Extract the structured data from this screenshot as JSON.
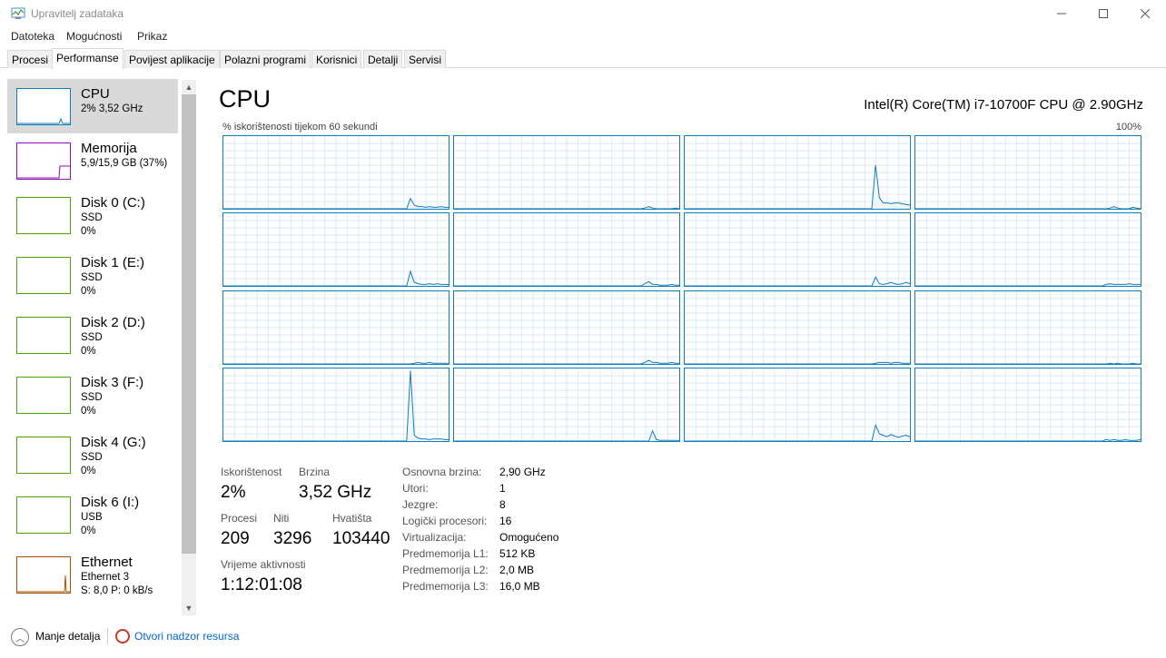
{
  "window": {
    "title": "Upravitelj zadataka",
    "icons": {
      "app": "task-manager-icon",
      "minimize": "minimize-icon",
      "maximize": "maximize-icon",
      "close": "close-icon"
    }
  },
  "menu": [
    "Datoteka",
    "Mogućnosti",
    "Prikaz"
  ],
  "tabs": [
    {
      "label": "Procesi",
      "active": false
    },
    {
      "label": "Performanse",
      "active": true
    },
    {
      "label": "Povijest aplikacije",
      "active": false
    },
    {
      "label": "Polazni programi",
      "active": false
    },
    {
      "label": "Korisnici",
      "active": false
    },
    {
      "label": "Detalji",
      "active": false
    },
    {
      "label": "Servisi",
      "active": false
    }
  ],
  "sidebar": {
    "items": [
      {
        "name": "CPU",
        "line1": "2% 3,52 GHz",
        "line2": "",
        "color": "#117dbb",
        "selected": true
      },
      {
        "name": "Memorija",
        "line1": "5,9/15,9 GB (37%)",
        "line2": "",
        "color": "#8b12ae",
        "selected": false
      },
      {
        "name": "Disk 0 (C:)",
        "line1": "SSD",
        "line2": "0%",
        "color": "#4da60c",
        "selected": false
      },
      {
        "name": "Disk 1 (E:)",
        "line1": "SSD",
        "line2": "0%",
        "color": "#4da60c",
        "selected": false
      },
      {
        "name": "Disk 2 (D:)",
        "line1": "SSD",
        "line2": "0%",
        "color": "#4da60c",
        "selected": false
      },
      {
        "name": "Disk 3 (F:)",
        "line1": "SSD",
        "line2": "0%",
        "color": "#4da60c",
        "selected": false
      },
      {
        "name": "Disk 4 (G:)",
        "line1": "SSD",
        "line2": "0%",
        "color": "#4da60c",
        "selected": false
      },
      {
        "name": "Disk 6 (I:)",
        "line1": "USB",
        "line2": "0%",
        "color": "#4da60c",
        "selected": false
      },
      {
        "name": "Ethernet",
        "line1": "Ethernet 3",
        "line2": "S: 8,0 P: 0 kB/s",
        "color": "#a74f01",
        "selected": false
      }
    ]
  },
  "main": {
    "title": "CPU",
    "model": "Intel(R) Core(TM) i7-10700F CPU @ 2.90GHz",
    "graph_caption": "% iskorištenosti tijekom 60 sekundi",
    "graph_max": "100%",
    "accent_color": "#117dbb"
  },
  "stats": {
    "utilization_label": "Iskorištenost",
    "utilization_value": "2%",
    "speed_label": "Brzina",
    "speed_value": "3,52 GHz",
    "processes_label": "Procesi",
    "processes_value": "209",
    "threads_label": "Niti",
    "threads_value": "3296",
    "handles_label": "Hvatišta",
    "handles_value": "103440",
    "uptime_label": "Vrijeme aktivnosti",
    "uptime_value": "1:12:01:08"
  },
  "info": [
    {
      "label": "Osnovna brzina:",
      "value": "2,90 GHz"
    },
    {
      "label": "Utori:",
      "value": "1"
    },
    {
      "label": "Jezgre:",
      "value": "8"
    },
    {
      "label": "Logički procesori:",
      "value": "16"
    },
    {
      "label": "Virtualizacija:",
      "value": "Omogućeno"
    },
    {
      "label": "Predmemorija L1:",
      "value": "512 KB"
    },
    {
      "label": "Predmemorija L2:",
      "value": "2,0 MB"
    },
    {
      "label": "Predmemorija L3:",
      "value": "16,0 MB"
    }
  ],
  "footer": {
    "toggle_label": "Manje detalja",
    "resmon_label": "Otvori nadzor resursa"
  },
  "chart_data": {
    "type": "line",
    "xlabel": "% iskorištenosti tijekom 60 sekundi",
    "ylim": [
      0,
      100
    ],
    "series": [
      {
        "values": [
          0,
          0,
          0,
          0,
          0,
          0,
          0,
          0,
          0,
          0,
          0,
          0,
          0,
          0,
          0,
          0,
          0,
          0,
          0,
          0,
          0,
          0,
          0,
          0,
          0,
          0,
          0,
          0,
          0,
          0,
          0,
          0,
          0,
          0,
          0,
          0,
          0,
          0,
          0,
          0,
          0,
          0,
          0,
          0,
          0,
          0,
          0,
          0,
          0,
          14,
          5,
          3,
          3,
          2,
          3,
          2,
          2,
          3,
          2,
          2
        ]
      },
      {
        "values": [
          0,
          0,
          0,
          0,
          0,
          0,
          0,
          0,
          0,
          0,
          0,
          0,
          0,
          0,
          0,
          0,
          0,
          0,
          0,
          0,
          0,
          0,
          0,
          0,
          0,
          0,
          0,
          0,
          0,
          0,
          0,
          0,
          0,
          0,
          0,
          0,
          0,
          0,
          0,
          0,
          0,
          0,
          0,
          0,
          0,
          0,
          0,
          0,
          0,
          0,
          1,
          3,
          1,
          0,
          0,
          0,
          0,
          0,
          1,
          0
        ]
      },
      {
        "values": [
          0,
          0,
          0,
          0,
          0,
          0,
          0,
          0,
          0,
          0,
          0,
          0,
          0,
          0,
          0,
          0,
          0,
          0,
          0,
          0,
          0,
          0,
          0,
          0,
          0,
          0,
          0,
          0,
          0,
          0,
          0,
          0,
          0,
          0,
          0,
          0,
          0,
          0,
          0,
          0,
          0,
          0,
          0,
          0,
          0,
          0,
          0,
          0,
          0,
          0,
          60,
          15,
          8,
          8,
          7,
          8,
          8,
          7,
          6,
          5
        ]
      },
      {
        "values": [
          0,
          0,
          0,
          0,
          0,
          0,
          0,
          0,
          0,
          0,
          0,
          0,
          0,
          0,
          0,
          0,
          0,
          0,
          0,
          0,
          0,
          0,
          0,
          0,
          0,
          0,
          0,
          0,
          0,
          0,
          0,
          0,
          0,
          0,
          0,
          0,
          0,
          0,
          0,
          0,
          0,
          0,
          0,
          0,
          0,
          0,
          0,
          0,
          0,
          0,
          0,
          1,
          3,
          1,
          0,
          0,
          0,
          2,
          1,
          0
        ]
      },
      {
        "values": [
          0,
          0,
          0,
          0,
          0,
          0,
          0,
          0,
          0,
          0,
          0,
          0,
          0,
          0,
          0,
          0,
          0,
          0,
          0,
          0,
          0,
          0,
          0,
          0,
          0,
          0,
          0,
          0,
          0,
          0,
          0,
          0,
          0,
          0,
          0,
          0,
          0,
          0,
          0,
          0,
          0,
          0,
          0,
          0,
          0,
          0,
          0,
          0,
          0,
          20,
          5,
          3,
          2,
          2,
          3,
          2,
          3,
          2,
          2,
          2
        ]
      },
      {
        "values": [
          0,
          0,
          0,
          0,
          0,
          0,
          0,
          0,
          0,
          0,
          0,
          0,
          0,
          0,
          0,
          0,
          0,
          0,
          0,
          0,
          0,
          0,
          0,
          0,
          0,
          0,
          0,
          0,
          0,
          0,
          0,
          0,
          0,
          0,
          0,
          0,
          0,
          0,
          0,
          0,
          0,
          0,
          0,
          0,
          0,
          0,
          0,
          0,
          0,
          0,
          3,
          6,
          2,
          2,
          1,
          1,
          1,
          2,
          1,
          1
        ]
      },
      {
        "values": [
          0,
          0,
          0,
          0,
          0,
          0,
          0,
          0,
          0,
          0,
          0,
          0,
          0,
          0,
          0,
          0,
          0,
          0,
          0,
          0,
          0,
          0,
          0,
          0,
          0,
          0,
          0,
          0,
          0,
          0,
          0,
          0,
          0,
          0,
          0,
          0,
          0,
          0,
          0,
          0,
          0,
          0,
          0,
          0,
          0,
          0,
          0,
          0,
          0,
          0,
          12,
          3,
          2,
          3,
          5,
          3,
          2,
          3,
          5,
          3
        ]
      },
      {
        "values": [
          0,
          0,
          0,
          0,
          0,
          0,
          0,
          0,
          0,
          0,
          0,
          0,
          0,
          0,
          0,
          0,
          0,
          0,
          0,
          0,
          0,
          0,
          0,
          0,
          0,
          0,
          0,
          0,
          0,
          0,
          0,
          0,
          0,
          0,
          0,
          0,
          0,
          0,
          0,
          0,
          0,
          0,
          0,
          0,
          0,
          0,
          0,
          0,
          0,
          0,
          2,
          3,
          2,
          2,
          2,
          2,
          3,
          2,
          2,
          2
        ]
      },
      {
        "values": [
          0,
          0,
          0,
          0,
          0,
          0,
          0,
          0,
          0,
          0,
          0,
          0,
          0,
          0,
          0,
          0,
          0,
          0,
          0,
          0,
          0,
          0,
          0,
          0,
          0,
          0,
          0,
          0,
          0,
          0,
          0,
          0,
          0,
          0,
          0,
          0,
          0,
          0,
          0,
          0,
          0,
          0,
          0,
          0,
          0,
          0,
          0,
          0,
          0,
          0,
          1,
          2,
          1,
          1,
          2,
          1,
          1,
          1,
          1,
          1
        ]
      },
      {
        "values": [
          0,
          0,
          0,
          0,
          0,
          0,
          0,
          0,
          0,
          0,
          0,
          0,
          0,
          0,
          0,
          0,
          0,
          0,
          0,
          0,
          0,
          0,
          0,
          0,
          0,
          0,
          0,
          0,
          0,
          0,
          0,
          0,
          0,
          0,
          0,
          0,
          0,
          0,
          0,
          0,
          0,
          0,
          0,
          0,
          0,
          0,
          0,
          0,
          0,
          0,
          2,
          5,
          2,
          2,
          1,
          1,
          1,
          2,
          1,
          1
        ]
      },
      {
        "values": [
          0,
          0,
          0,
          0,
          0,
          0,
          0,
          0,
          0,
          0,
          0,
          0,
          0,
          0,
          0,
          0,
          0,
          0,
          0,
          0,
          0,
          0,
          0,
          0,
          0,
          0,
          0,
          0,
          0,
          0,
          0,
          0,
          0,
          0,
          0,
          0,
          0,
          0,
          0,
          0,
          0,
          0,
          0,
          0,
          0,
          0,
          0,
          0,
          0,
          0,
          1,
          2,
          2,
          2,
          1,
          2,
          2,
          1,
          1,
          1
        ]
      },
      {
        "values": [
          0,
          0,
          0,
          0,
          0,
          0,
          0,
          0,
          0,
          0,
          0,
          0,
          0,
          0,
          0,
          0,
          0,
          0,
          0,
          0,
          0,
          0,
          0,
          0,
          0,
          0,
          0,
          0,
          0,
          0,
          0,
          0,
          0,
          0,
          0,
          0,
          0,
          0,
          0,
          0,
          0,
          0,
          0,
          0,
          0,
          0,
          0,
          0,
          0,
          0,
          0,
          1,
          0,
          1,
          0,
          0,
          0,
          1,
          0,
          0
        ]
      },
      {
        "values": [
          0,
          0,
          0,
          0,
          0,
          0,
          0,
          0,
          0,
          0,
          0,
          0,
          0,
          0,
          0,
          0,
          0,
          0,
          0,
          0,
          0,
          0,
          0,
          0,
          0,
          0,
          0,
          0,
          0,
          0,
          0,
          0,
          0,
          0,
          0,
          0,
          0,
          0,
          0,
          0,
          0,
          0,
          0,
          0,
          0,
          0,
          0,
          0,
          0,
          97,
          8,
          4,
          3,
          3,
          2,
          3,
          3,
          3,
          2,
          2
        ]
      },
      {
        "values": [
          0,
          0,
          0,
          0,
          0,
          0,
          0,
          0,
          0,
          0,
          0,
          0,
          0,
          0,
          0,
          0,
          0,
          0,
          0,
          0,
          0,
          0,
          0,
          0,
          0,
          0,
          0,
          0,
          0,
          0,
          0,
          0,
          0,
          0,
          0,
          0,
          0,
          0,
          0,
          0,
          0,
          0,
          0,
          0,
          0,
          0,
          0,
          0,
          0,
          0,
          0,
          0,
          14,
          2,
          1,
          1,
          1,
          1,
          1,
          1
        ]
      },
      {
        "values": [
          0,
          0,
          0,
          0,
          0,
          0,
          0,
          0,
          0,
          0,
          0,
          0,
          0,
          0,
          0,
          0,
          0,
          0,
          0,
          0,
          0,
          0,
          0,
          0,
          0,
          0,
          0,
          0,
          0,
          0,
          0,
          0,
          0,
          0,
          0,
          0,
          0,
          0,
          0,
          0,
          0,
          0,
          0,
          0,
          0,
          0,
          0,
          0,
          0,
          0,
          22,
          10,
          8,
          6,
          9,
          7,
          5,
          7,
          8,
          6
        ]
      },
      {
        "values": [
          0,
          0,
          0,
          0,
          0,
          0,
          0,
          0,
          0,
          0,
          0,
          0,
          0,
          0,
          0,
          0,
          0,
          0,
          0,
          0,
          0,
          0,
          0,
          0,
          0,
          0,
          0,
          0,
          0,
          0,
          0,
          0,
          0,
          0,
          0,
          0,
          0,
          0,
          0,
          0,
          0,
          0,
          0,
          0,
          0,
          0,
          0,
          0,
          0,
          0,
          2,
          1,
          2,
          1,
          1,
          2,
          1,
          1,
          1,
          2
        ]
      }
    ]
  }
}
